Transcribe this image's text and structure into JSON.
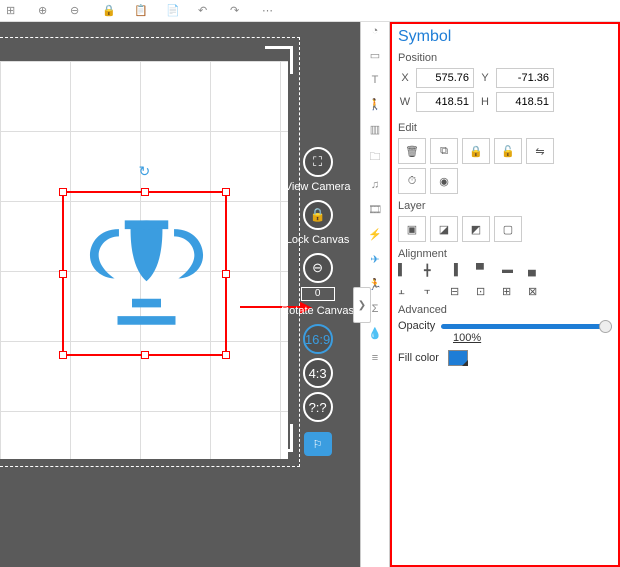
{
  "panel_title": "Symbol",
  "sections": {
    "position": "Position",
    "edit": "Edit",
    "layer": "Layer",
    "alignment": "Alignment",
    "advanced": "Advanced"
  },
  "pos": {
    "x_label": "X",
    "x": "575.76",
    "y_label": "Y",
    "y": "-71.36",
    "w_label": "W",
    "w": "418.51",
    "h_label": "H",
    "h": "418.51"
  },
  "quick": {
    "view_camera": "View Camera",
    "lock_canvas": "Lock Canvas",
    "rotate_canvas": "Rotate Canvas",
    "rotate_value": "0",
    "ratio1": "16:9",
    "ratio2": "4:3",
    "ratio3": "?:?"
  },
  "advanced": {
    "opacity_label": "Opacity",
    "opacity_value": "100%",
    "fillcolor_label": "Fill color"
  }
}
